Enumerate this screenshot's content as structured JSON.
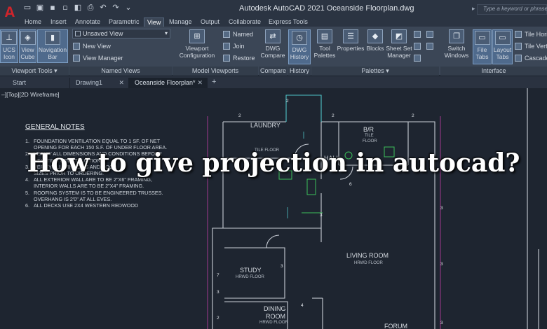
{
  "titlebar": {
    "window_title": "Autodesk AutoCAD 2021   Oceanside Floorplan.dwg",
    "search_placeholder": "Type a keyword or phrase"
  },
  "ribbon_tabs": [
    "Home",
    "Insert",
    "Annotate",
    "Parametric",
    "View",
    "Manage",
    "Output",
    "Collaborate",
    "Express Tools"
  ],
  "active_tab": "View",
  "ribbon": {
    "viewport_tools": {
      "label": "Viewport Tools",
      "ucs_icon": "UCS\nIcon",
      "view_cube": "View\nCube",
      "navigation_bar": "Navigation\nBar"
    },
    "named_views": {
      "label": "Named Views",
      "dropdown_value": "Unsaved View",
      "new_view": "New View",
      "view_manager": "View Manager"
    },
    "model_viewports": {
      "label": "Model Viewports",
      "viewport_configuration": "Viewport\nConfiguration",
      "named": "Named",
      "join": "Join",
      "restore": "Restore"
    },
    "compare": {
      "label": "Compare",
      "dwg_compare": "DWG\nCompare"
    },
    "history": {
      "label": "History",
      "dwg_history": "DWG\nHistory"
    },
    "palettes": {
      "label": "Palettes",
      "tool_palettes": "Tool\nPalettes",
      "properties": "Properties",
      "blocks": "Blocks",
      "sheet_set_manager": "Sheet Set\nManager"
    },
    "interface": {
      "label": "Interface",
      "switch_windows": "Switch\nWindows",
      "file_tabs": "File\nTabs",
      "layout_tabs": "Layout\nTabs",
      "tile_horizontally": "Tile Hori",
      "tile_vertically": "Tile Verti",
      "cascade": "Cascade"
    }
  },
  "file_tabs": [
    {
      "label": "Start"
    },
    {
      "label": "Drawing1"
    },
    {
      "label": "Oceanside Floorplan*"
    }
  ],
  "viewport_label": "–][Top][2D Wireframe]",
  "general_notes": {
    "title": "GENERAL NOTES",
    "items": [
      {
        "num": "1.",
        "lines": [
          "FOUNDATION VENTILATION EQUAL TO 1 SF. OF NET",
          "OPENING FOR EACH 150 S.F. OF UNDER FLOOR AREA."
        ]
      },
      {
        "num": "2.",
        "lines": [
          "VERIFY ALL DIMENSIONS AND CONDITIONS BEFORE",
          "STARTING CONSTRUCTION."
        ]
      },
      {
        "num": "3.",
        "lines": [
          "VERIFY ALL WINDOWS AND DOOR",
          "SIZES PRIOR TO ORDERING."
        ]
      },
      {
        "num": "4.",
        "lines": [
          "ALL EXTERIOR WALL ARE TO BE 2\"X6\" FRAMING,",
          "INTERIOR WALLS ARE TO BE 2\"X4\" FRAMING."
        ]
      },
      {
        "num": "5.",
        "lines": [
          "ROOFING SYSTEM IS TO BE ENGINEERED TRUSSES.",
          "OVERHANG IS 2'0\" AT ALL EVES."
        ]
      },
      {
        "num": "6.",
        "lines": [
          "ALL DECKS USE 2X4 WESTERN REDWOOD"
        ]
      }
    ]
  },
  "rooms": {
    "laundry": {
      "name": "LAUNDRY",
      "floor": "TILE FLOOR"
    },
    "bath": {
      "name": "B/R",
      "floor_1": "TILE",
      "floor_2": "FLOOR"
    },
    "hall": {
      "name": "HALL"
    },
    "living": {
      "name": "LIVING ROOM",
      "floor": "HRWD FLOOR"
    },
    "study": {
      "name": "STUDY",
      "floor": "HRWD FLOOR"
    },
    "dining": {
      "name": "DINING",
      "sub": "ROOM",
      "floor": "HRWD FLOOR"
    },
    "forum": {
      "name": "FORUM"
    }
  },
  "tags": [
    "2",
    "2",
    "2",
    "2",
    "6",
    "3",
    "3",
    "3",
    "7",
    "3",
    "3",
    "4",
    "2",
    "3"
  ],
  "overlay_title": "How to give projection in autocad?",
  "colors": {
    "accent": "#d0242b",
    "canvas_bg": "#1e2530",
    "wall": "#c9ced6",
    "cyan": "#4fc3c7",
    "green": "#3cc05a",
    "magenta": "#c23fa8"
  }
}
